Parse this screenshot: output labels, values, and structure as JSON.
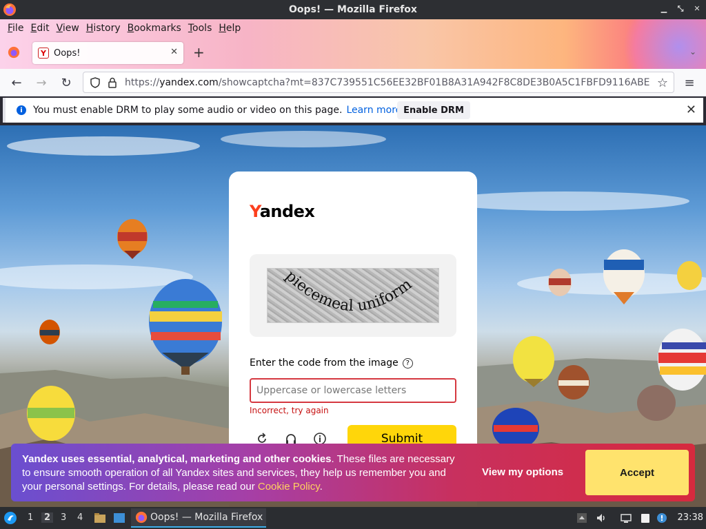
{
  "window": {
    "title": "Oops! — Mozilla Firefox"
  },
  "menu": {
    "items": [
      {
        "label": "File",
        "accel": "F",
        "rest": "ile"
      },
      {
        "label": "Edit",
        "accel": "E",
        "rest": "dit"
      },
      {
        "label": "View",
        "accel": "V",
        "rest": "iew"
      },
      {
        "label": "History",
        "accel": "H",
        "rest": "istory"
      },
      {
        "label": "Bookmarks",
        "accel": "B",
        "rest": "ookmarks"
      },
      {
        "label": "Tools",
        "accel": "T",
        "rest": "ools"
      },
      {
        "label": "Help",
        "accel": "H",
        "rest": "elp"
      }
    ]
  },
  "tab": {
    "title": "Oops!",
    "favicon": "Y",
    "close": "✕",
    "new_tab": "+"
  },
  "nav": {
    "url_scheme": "https://",
    "url_host": "yandex.com",
    "url_rest": "/showcaptcha?mt=837C739551C56EE32BF01B8A31A942F8C8DE3B0A5C1FBFD9116ABE"
  },
  "drm": {
    "message": "You must enable DRM to play some audio or video on this page.",
    "learn_more": "Learn more",
    "enable_button": "Enable DRM",
    "close": "✕"
  },
  "captcha": {
    "logo_y": "Y",
    "logo_rest": "andex",
    "captcha_text": "piecemeal uniform",
    "prompt": "Enter the code from the image",
    "help": "?",
    "input_placeholder": "Uppercase or lowercase letters",
    "input_value": "",
    "error": "Incorrect, try again",
    "submit": "Submit"
  },
  "cookie": {
    "bold": "Yandex uses essential, analytical, marketing and other cookies",
    "text": ". These files are necessary to ensure smooth operation of all Yandex sites and services, they help us remember you and your personal settings. For details, please read our ",
    "policy_link": "Cookie Policy",
    "period": ".",
    "options_button": "View my options",
    "accept_button": "Accept"
  },
  "taskbar": {
    "workspaces": [
      "1",
      "2",
      "3",
      "4"
    ],
    "active_workspace": "2",
    "window_title": "Oops! — Mozilla Firefox",
    "clock": "23:38"
  },
  "colors": {
    "yandex_red": "#fc3f1d",
    "submit_yellow": "#ffd60a",
    "error_red": "#c61010",
    "firefox_blue": "#0060df"
  }
}
